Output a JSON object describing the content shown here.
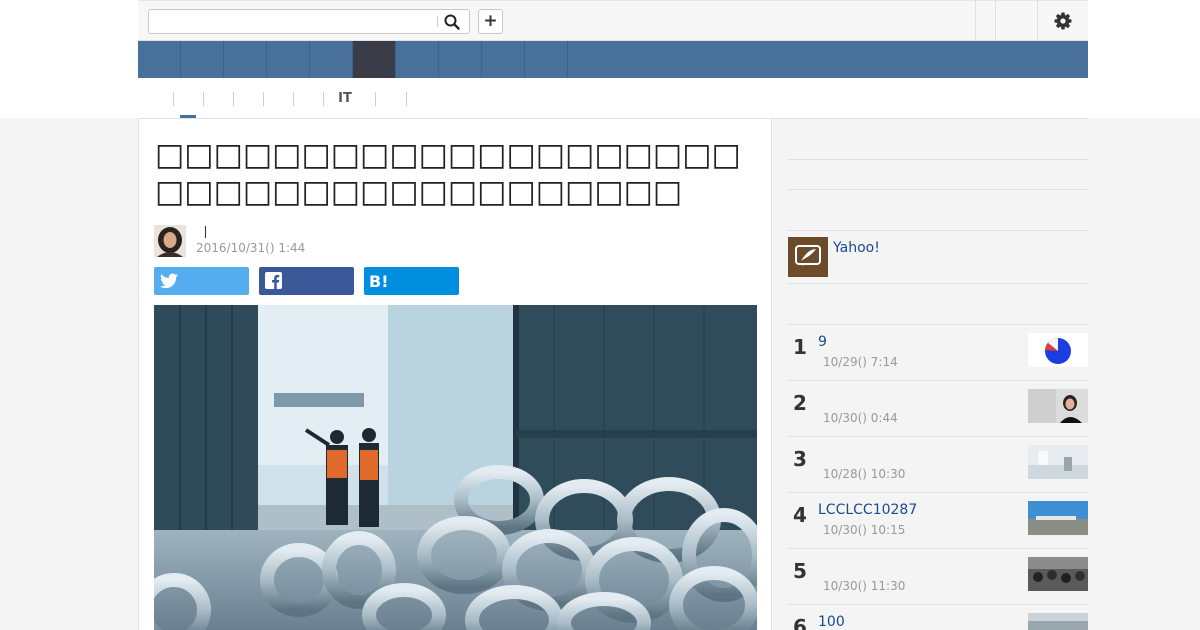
{
  "search": {
    "placeholder": "",
    "value": ""
  },
  "toolbar": {
    "add_label": "+"
  },
  "nav": {
    "items": [
      {
        "label": ""
      },
      {
        "label": ""
      },
      {
        "label": ""
      },
      {
        "label": ""
      },
      {
        "label": ""
      },
      {
        "label": ""
      },
      {
        "label": ""
      },
      {
        "label": ""
      },
      {
        "label": ""
      },
      {
        "label": ""
      }
    ],
    "active_index": 5,
    "colors": {
      "bar": "#48709a",
      "active": "#3a3d47"
    }
  },
  "subnav": {
    "items": [
      {
        "label": ""
      },
      {
        "label": ""
      },
      {
        "label": ""
      },
      {
        "label": ""
      },
      {
        "label": ""
      },
      {
        "label": "IT"
      },
      {
        "label": ""
      }
    ]
  },
  "article": {
    "title": "□□□□□□□□□□□□□□□□□□□□□□□□□□□□□□□□□□□□□□",
    "author_name": "",
    "date": "2016/10/31() 1:44",
    "share": {
      "twitter": "",
      "facebook": "",
      "hatena": ""
    },
    "icons": {
      "twitter": "twitter-icon",
      "facebook": "facebook-icon",
      "hatena": "hatena-bookmark-icon"
    }
  },
  "sidebar": {
    "promo": {
      "text": "Yahoo!"
    },
    "ranking": [
      {
        "rank": "1",
        "title": "9",
        "date": "10/29() 7:14"
      },
      {
        "rank": "2",
        "title": "",
        "date": "10/30() 0:44"
      },
      {
        "rank": "3",
        "title": "",
        "date": "10/28() 10:30"
      },
      {
        "rank": "4",
        "title": "LCCLCC10287",
        "date": "10/30() 10:15"
      },
      {
        "rank": "5",
        "title": "",
        "date": "10/30() 11:30"
      },
      {
        "rank": "6",
        "title": "100",
        "date": ""
      }
    ]
  },
  "colors": {
    "accent": "#48709a",
    "link": "#1a4a8f",
    "twitter": "#55acee",
    "facebook": "#3b5998",
    "hatena": "#008fde"
  }
}
